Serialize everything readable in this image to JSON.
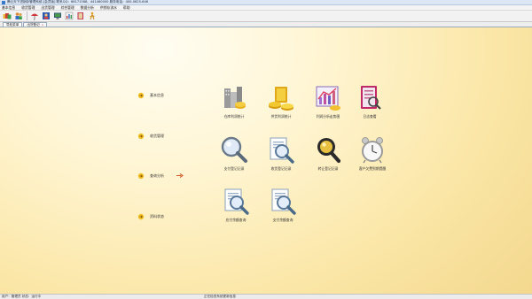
{
  "titlebar": {
    "title": "腾云天下进销存管理系统-[会员版] 联系QQ：86171588、441460000 服务电话：400-0625-646"
  },
  "menu": [
    "基本信息",
    "收货管理",
    "出货管理",
    "综合管理",
    "数据分析",
    "供销存流水",
    "帮助"
  ],
  "toolbar": {
    "buttons": [
      "folders-icon",
      "user-group-icon",
      "umbrella-icon",
      "contacts-icon",
      "monitor-icon",
      "chart-icon",
      "book-icon",
      "exit-icon"
    ]
  },
  "tabs": [
    {
      "label": "导航菜单",
      "close": ""
    },
    {
      "label": "出货登记",
      "close": "×"
    }
  ],
  "sidebar": [
    {
      "label": "基本信息"
    },
    {
      "label": "收货管理"
    },
    {
      "label": "查询分析"
    },
    {
      "label": "资料状态"
    }
  ],
  "tiles": [
    {
      "label": "仓库利润统计",
      "icon": "buildings-icon"
    },
    {
      "label": "供货利润统计",
      "icon": "gold-coins-icon"
    },
    {
      "label": "利润分析走势图",
      "icon": "trend-chart-icon"
    },
    {
      "label": "日志查看",
      "icon": "log-book-icon"
    },
    {
      "label": "支付登记记录",
      "icon": "magnifier-icon"
    },
    {
      "label": "收货登记记录",
      "icon": "doc-search-icon"
    },
    {
      "label": "转让登记记录",
      "icon": "dark-magnifier-icon"
    },
    {
      "label": "客户欠费到期提醒",
      "icon": "alarm-clock-icon"
    },
    {
      "label": "应付余额查询",
      "icon": "doc-search-icon"
    },
    {
      "label": "支付余额查询",
      "icon": "doc-search-icon"
    }
  ],
  "status": {
    "left": "用户：管理员   状态：运行中",
    "center": "正在检查系统更新信息"
  }
}
